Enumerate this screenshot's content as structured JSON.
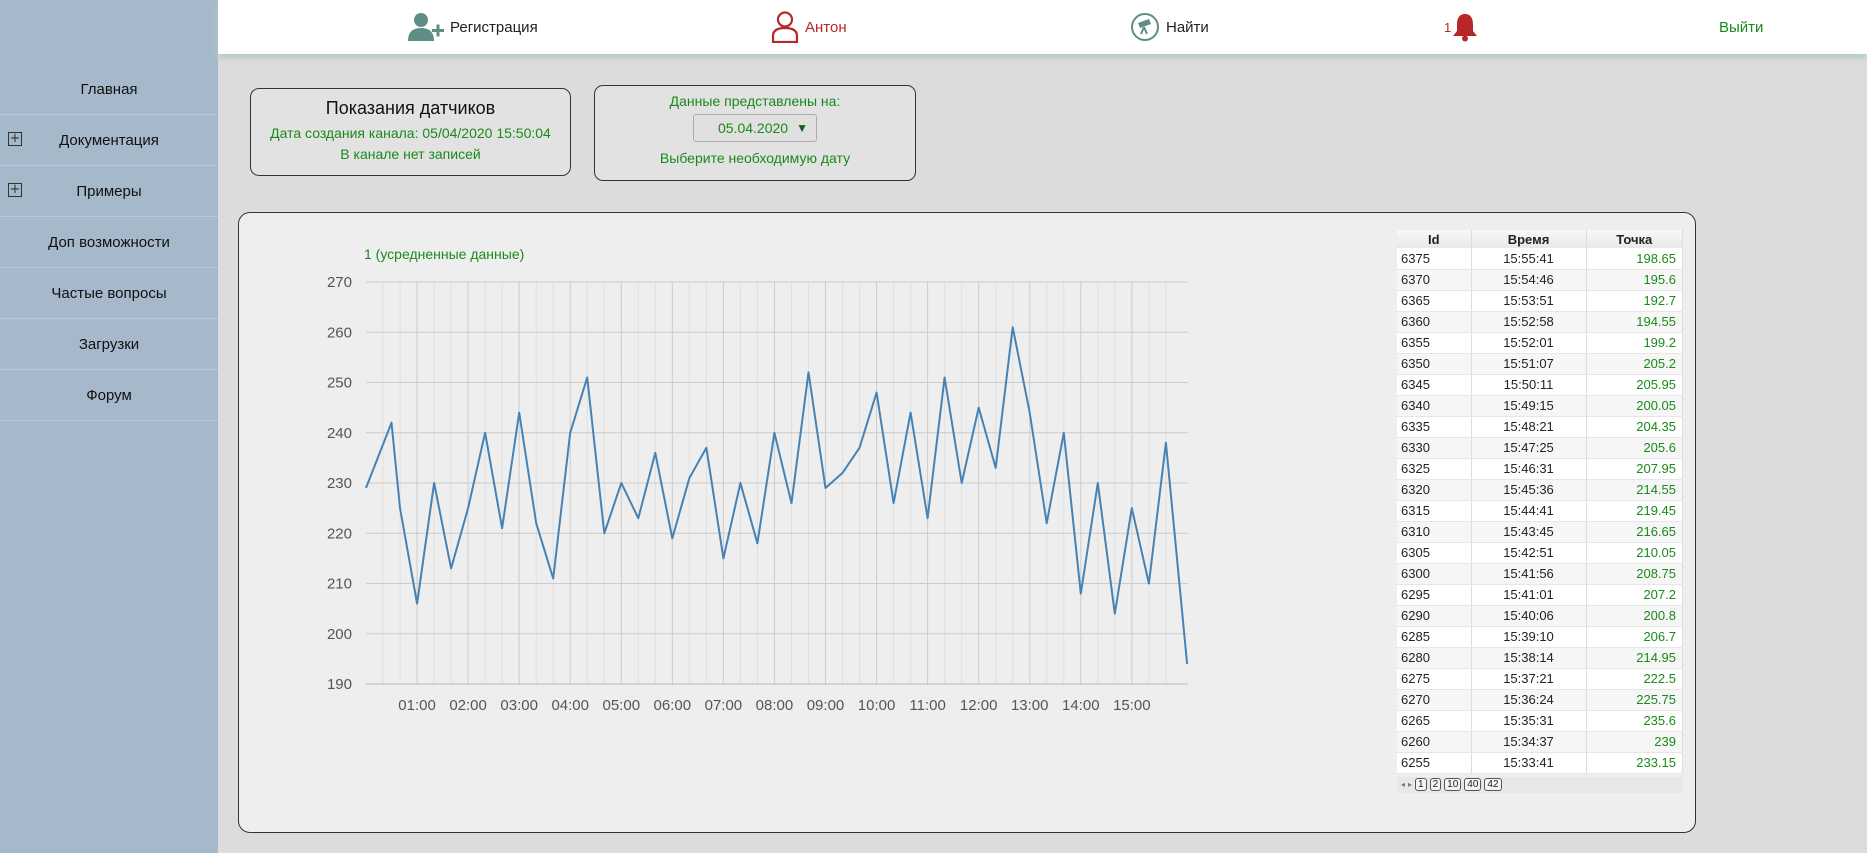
{
  "topbar": {
    "register_label": "Регистрация",
    "user_label": "Антон",
    "find_label": "Найти",
    "notification_count": "1",
    "logout_label": "Выйти"
  },
  "sidebar": {
    "items": [
      {
        "label": "Главная",
        "expandable": false
      },
      {
        "label": "Документация",
        "expandable": true
      },
      {
        "label": "Примеры",
        "expandable": true
      },
      {
        "label": "Доп возможности",
        "expandable": false
      },
      {
        "label": "Частые вопросы",
        "expandable": false
      },
      {
        "label": "Загрузки",
        "expandable": false
      },
      {
        "label": "Форум",
        "expandable": false
      }
    ]
  },
  "sensor_box": {
    "title": "Показания датчиков",
    "created": "Дата создания канала: 05/04/2020 15:50:04",
    "no_records": "В канале нет записей"
  },
  "date_box": {
    "label": "Данные представлены на:",
    "selected_date": "05.04.2020",
    "hint": "Выберите необходимую дату"
  },
  "chart_data": {
    "type": "line",
    "title": "1 (усредненные данные)",
    "xlabel": "",
    "ylabel": "",
    "ylim": [
      190,
      270
    ],
    "yticks": [
      190,
      200,
      210,
      220,
      230,
      240,
      250,
      260,
      270
    ],
    "xlim_hours": [
      0,
      16.1
    ],
    "xticks": [
      "01:00",
      "02:00",
      "03:00",
      "04:00",
      "05:00",
      "06:00",
      "07:00",
      "08:00",
      "09:00",
      "10:00",
      "11:00",
      "12:00",
      "13:00",
      "14:00",
      "15:00"
    ],
    "grid": true,
    "legend": "none",
    "line_color": "#4682b4",
    "series": [
      {
        "x_time": [
          "00:00",
          "00:30",
          "00:40",
          "01:00",
          "01:20",
          "01:40",
          "02:00",
          "02:20",
          "02:40",
          "03:00",
          "03:20",
          "03:40",
          "04:00",
          "04:20",
          "04:40",
          "05:00",
          "05:20",
          "05:40",
          "06:00",
          "06:20",
          "06:40",
          "07:00",
          "07:20",
          "07:40",
          "08:00",
          "08:20",
          "08:40",
          "09:00",
          "09:20",
          "09:40",
          "10:00",
          "10:20",
          "10:40",
          "11:00",
          "11:20",
          "11:40",
          "12:00",
          "12:20",
          "12:40",
          "13:00",
          "13:20",
          "13:40",
          "14:00",
          "14:20",
          "14:40",
          "15:00",
          "15:20",
          "15:40",
          "16:05"
        ],
        "values": [
          229,
          242,
          225,
          206,
          230,
          213,
          225,
          240,
          221,
          244,
          222,
          211,
          240,
          251,
          220,
          230,
          223,
          236,
          219,
          231,
          237,
          215,
          230,
          218,
          240,
          226,
          252,
          229,
          232,
          237,
          248,
          226,
          244,
          223,
          251,
          230,
          245,
          233,
          261,
          244,
          222,
          240,
          208,
          230,
          204,
          225,
          210,
          238,
          194
        ]
      }
    ]
  },
  "table": {
    "headers": [
      "Id",
      "Время",
      "Точка"
    ],
    "rows": [
      [
        "6375",
        "15:55:41",
        "198.65"
      ],
      [
        "6370",
        "15:54:46",
        "195.6"
      ],
      [
        "6365",
        "15:53:51",
        "192.7"
      ],
      [
        "6360",
        "15:52:58",
        "194.55"
      ],
      [
        "6355",
        "15:52:01",
        "199.2"
      ],
      [
        "6350",
        "15:51:07",
        "205.2"
      ],
      [
        "6345",
        "15:50:11",
        "205.95"
      ],
      [
        "6340",
        "15:49:15",
        "200.05"
      ],
      [
        "6335",
        "15:48:21",
        "204.35"
      ],
      [
        "6330",
        "15:47:25",
        "205.6"
      ],
      [
        "6325",
        "15:46:31",
        "207.95"
      ],
      [
        "6320",
        "15:45:36",
        "214.55"
      ],
      [
        "6315",
        "15:44:41",
        "219.45"
      ],
      [
        "6310",
        "15:43:45",
        "216.65"
      ],
      [
        "6305",
        "15:42:51",
        "210.05"
      ],
      [
        "6300",
        "15:41:56",
        "208.75"
      ],
      [
        "6295",
        "15:41:01",
        "207.2"
      ],
      [
        "6290",
        "15:40:06",
        "200.8"
      ],
      [
        "6285",
        "15:39:10",
        "206.7"
      ],
      [
        "6280",
        "15:38:14",
        "214.95"
      ],
      [
        "6275",
        "15:37:21",
        "222.5"
      ],
      [
        "6270",
        "15:36:24",
        "225.75"
      ],
      [
        "6265",
        "15:35:31",
        "235.6"
      ],
      [
        "6260",
        "15:34:37",
        "239"
      ],
      [
        "6255",
        "15:33:41",
        "233.15"
      ]
    ],
    "pager": [
      "1",
      "2",
      "10",
      "40",
      "42"
    ]
  }
}
